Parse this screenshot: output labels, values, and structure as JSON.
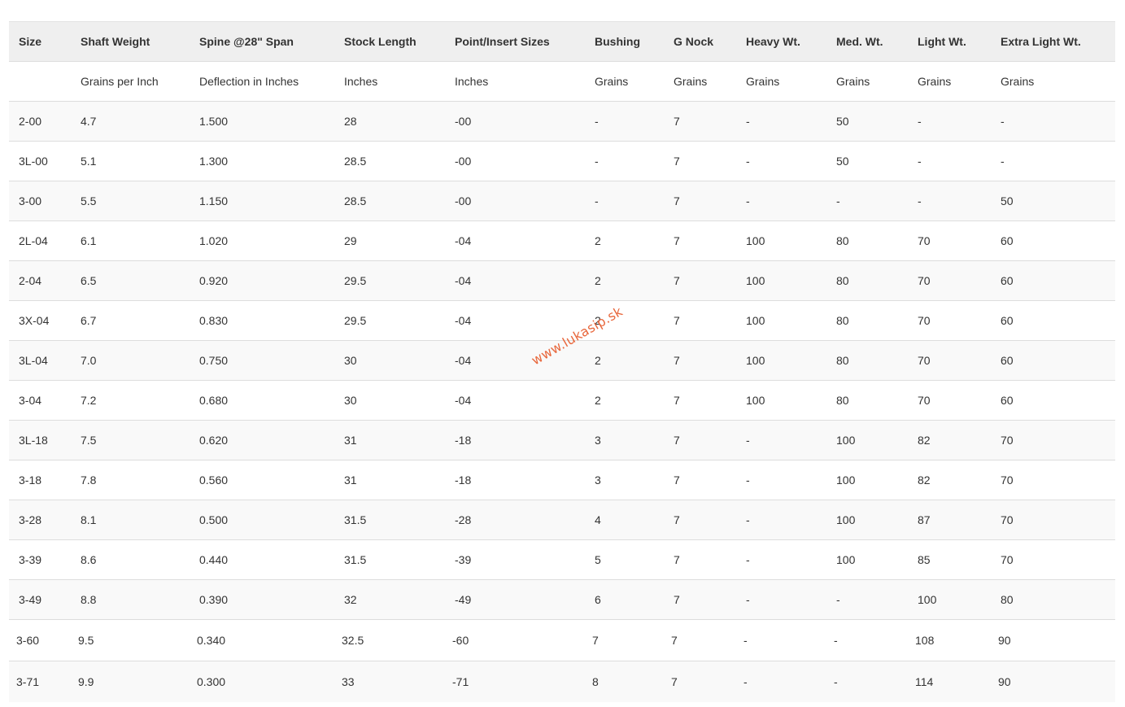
{
  "columns": [
    {
      "header": "Size",
      "unit": ""
    },
    {
      "header": "Shaft Weight",
      "unit": "Grains per Inch"
    },
    {
      "header": "Spine @28\" Span",
      "unit": "Deflection in Inches"
    },
    {
      "header": "Stock Length",
      "unit": "Inches"
    },
    {
      "header": "Point/Insert Sizes",
      "unit": "Inches"
    },
    {
      "header": "Bushing",
      "unit": "Grains"
    },
    {
      "header": "G Nock",
      "unit": "Grains"
    },
    {
      "header": "Heavy Wt.",
      "unit": "Grains"
    },
    {
      "header": "Med. Wt.",
      "unit": "Grains"
    },
    {
      "header": "Light Wt.",
      "unit": "Grains"
    },
    {
      "header": "Extra Light Wt.",
      "unit": "Grains"
    }
  ],
  "rows": [
    [
      "2-00",
      "4.7",
      "1.500",
      "28",
      "-00",
      "-",
      "7",
      "-",
      "50",
      "-",
      "-"
    ],
    [
      "3L-00",
      "5.1",
      "1.300",
      "28.5",
      "-00",
      "-",
      "7",
      "-",
      "50",
      "-",
      "-"
    ],
    [
      "3-00",
      "5.5",
      "1.150",
      "28.5",
      "-00",
      "-",
      "7",
      "-",
      "-",
      "-",
      "50"
    ],
    [
      "2L-04",
      "6.1",
      "1.020",
      "29",
      "-04",
      "2",
      "7",
      "100",
      "80",
      "70",
      "60"
    ],
    [
      "2-04",
      "6.5",
      "0.920",
      "29.5",
      "-04",
      "2",
      "7",
      "100",
      "80",
      "70",
      "60"
    ],
    [
      "3X-04",
      "6.7",
      "0.830",
      "29.5",
      "-04",
      "2",
      "7",
      "100",
      "80",
      "70",
      "60"
    ],
    [
      "3L-04",
      "7.0",
      "0.750",
      "30",
      "-04",
      "2",
      "7",
      "100",
      "80",
      "70",
      "60"
    ],
    [
      "3-04",
      "7.2",
      "0.680",
      "30",
      "-04",
      "2",
      "7",
      "100",
      "80",
      "70",
      "60"
    ],
    [
      "3L-18",
      "7.5",
      "0.620",
      "31",
      "-18",
      "3",
      "7",
      "-",
      "100",
      "82",
      "70"
    ],
    [
      "3-18",
      "7.8",
      "0.560",
      "31",
      "-18",
      "3",
      "7",
      "-",
      "100",
      "82",
      "70"
    ],
    [
      "3-28",
      "8.1",
      "0.500",
      "31.5",
      "-28",
      "4",
      "7",
      "-",
      "100",
      "87",
      "70"
    ],
    [
      "3-39",
      "8.6",
      "0.440",
      "31.5",
      "-39",
      "5",
      "7",
      "-",
      "100",
      "85",
      "70"
    ],
    [
      "3-49",
      "8.8",
      "0.390",
      "32",
      "-49",
      "6",
      "7",
      "-",
      "-",
      "100",
      "80"
    ],
    [
      "3-60",
      "9.5",
      "0.340",
      "32.5",
      "-60",
      "7",
      "7",
      "-",
      "-",
      "108",
      "90"
    ],
    [
      "3-71",
      "9.9",
      "0.300",
      "33",
      "-71",
      "8",
      "7",
      "-",
      "-",
      "114",
      "90"
    ]
  ],
  "watermark": "www.lukasip.sk",
  "colors": {
    "header_bg": "#efefef",
    "stripe_bg": "#f9f9f9",
    "border": "#dddddd",
    "text": "#333333",
    "watermark": "#e8673c"
  }
}
